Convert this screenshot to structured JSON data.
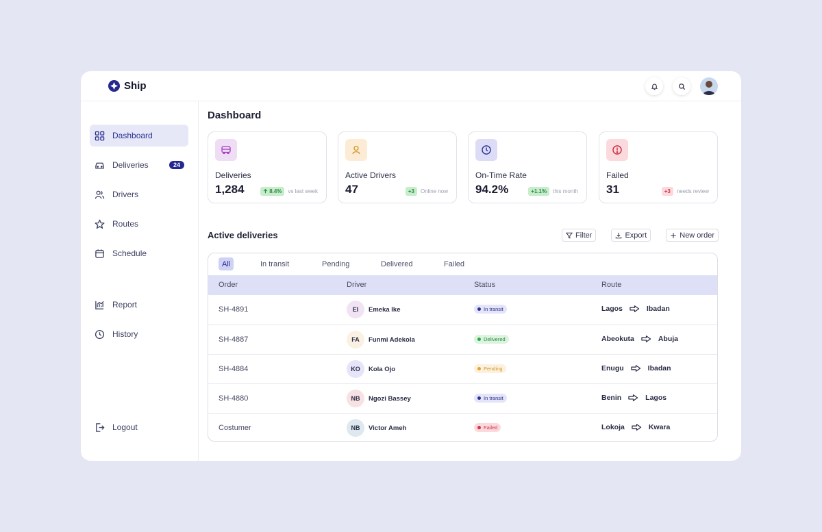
{
  "brand": {
    "name": "Ship",
    "accent": "#25288f"
  },
  "header": {
    "icons": [
      "bell-icon",
      "search-icon",
      "avatar"
    ]
  },
  "sidebar": {
    "items": [
      {
        "label": "Dashboard",
        "icon": "grid-icon",
        "active": true
      },
      {
        "label": "Deliveries",
        "icon": "car-icon",
        "badge": "24"
      },
      {
        "label": "Drivers",
        "icon": "users-icon"
      },
      {
        "label": "Routes",
        "icon": "star-icon"
      },
      {
        "label": "Schedule",
        "icon": "calendar-icon"
      },
      {
        "label": "Report",
        "icon": "chart-icon"
      },
      {
        "label": "History",
        "icon": "clock-icon"
      },
      {
        "label": "Logout",
        "icon": "logout-icon"
      }
    ]
  },
  "main": {
    "title": "Dashboard",
    "cards": [
      {
        "label": "Deliveries",
        "value": "1,284",
        "chip": "8.4%",
        "meta": "vs last week",
        "icon": "bus-icon"
      },
      {
        "label": "Active Drivers",
        "value": "47",
        "chip": "+3",
        "meta": "Online now",
        "icon": "user-icon"
      },
      {
        "label": "On-Time Rate",
        "value": "94.2%",
        "chip": "+1.1%",
        "meta": "this month",
        "icon": "clock-icon"
      },
      {
        "label": "Failed",
        "value": "31",
        "chip": "+3",
        "meta": "needs review",
        "icon": "alert-icon"
      }
    ],
    "section_title": "Active deliveries",
    "actions": {
      "filter": "Filter",
      "export": "Export",
      "new_order": "New order"
    },
    "tabs": [
      "All",
      "In transit",
      "Pending",
      "Delivered",
      "Failed"
    ],
    "columns": [
      "Order",
      "Driver",
      "Status",
      "Route"
    ],
    "rows": [
      {
        "order": "SH-4891",
        "initials": "EI",
        "driver": "Emeka Ike",
        "status": "In transit",
        "from": "Lagos",
        "to": "Ibadan"
      },
      {
        "order": "SH-4887",
        "initials": "FA",
        "driver": "Funmi Adekola",
        "status": "Delivered",
        "from": "Abeokuta",
        "to": "Abuja"
      },
      {
        "order": "SH-4884",
        "initials": "KO",
        "driver": "Kola Ojo",
        "status": "Pending",
        "from": "Enugu",
        "to": "Ibadan"
      },
      {
        "order": "SH-4880",
        "initials": "NB",
        "driver": "Ngozi Bassey",
        "status": "In transit",
        "from": "Benin",
        "to": "Lagos"
      },
      {
        "order": "Costumer",
        "initials": "NB",
        "driver": "Victor Ameh",
        "status": "Failed",
        "from": "Lokoja",
        "to": "Kwara"
      }
    ]
  }
}
